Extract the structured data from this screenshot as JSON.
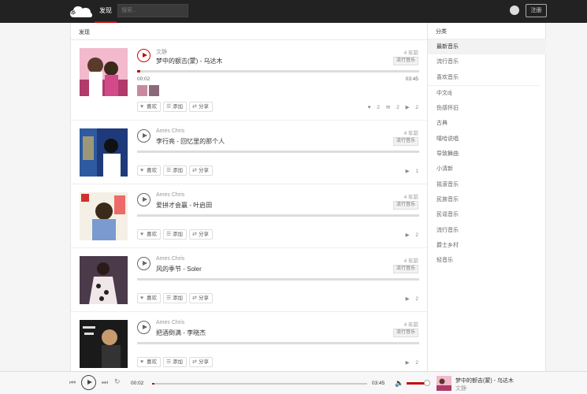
{
  "header": {
    "nav_active": "发现",
    "search_placeholder": "搜索...",
    "register_label": "注册"
  },
  "main": {
    "title": "发现",
    "songs": [
      {
        "artist": "文静",
        "title": "梦中的额吉(蒙) - 乌达木",
        "time": "4 年前",
        "tag": "流行音乐",
        "current_time": "00:02",
        "duration": "03:45",
        "progress": 0.01,
        "like_label": "喜欢",
        "add_label": "添加",
        "share_label": "分享",
        "likes": "2",
        "comments": "2",
        "plays": "2"
      },
      {
        "artist": "Ames Chris",
        "title": "李行亮 - 回忆里的那个人",
        "time": "4 年前",
        "tag": "流行音乐",
        "like_label": "喜欢",
        "add_label": "添加",
        "share_label": "分享",
        "plays": "1"
      },
      {
        "artist": "Ames Chris",
        "title": "爱拼才会赢 - 叶启田",
        "time": "4 年前",
        "tag": "流行音乐",
        "like_label": "喜欢",
        "add_label": "添加",
        "share_label": "分享",
        "plays": "2"
      },
      {
        "artist": "Ames Chris",
        "title": "风的季节 - Soler",
        "time": "4 年前",
        "tag": "流行音乐",
        "like_label": "喜欢",
        "add_label": "添加",
        "share_label": "分享",
        "plays": "2"
      },
      {
        "artist": "Ames Chris",
        "title": "把酒倒满 - 李晓杰",
        "time": "4 年前",
        "tag": "流行音乐",
        "like_label": "喜欢",
        "add_label": "添加",
        "share_label": "分享",
        "plays": "2"
      }
    ]
  },
  "sidebar": {
    "title": "分类",
    "items": [
      "最新音乐",
      "流行音乐",
      "喜欢音乐",
      "中文dj",
      "伤感怀旧",
      "古典",
      "嘻哈说唱",
      "导致舞曲",
      "小清新",
      "摇滚音乐",
      "民族音乐",
      "民谣音乐",
      "流行音乐",
      "爵士乡村",
      "轻音乐"
    ]
  },
  "player": {
    "current_time": "00:02",
    "duration": "03:45",
    "progress": 0.01,
    "volume": 0.8,
    "title": "梦中的额吉(蒙) - 乌达木",
    "artist": "文静"
  },
  "colors": {
    "accent": "#c20c0c",
    "topbar": "#222222"
  }
}
